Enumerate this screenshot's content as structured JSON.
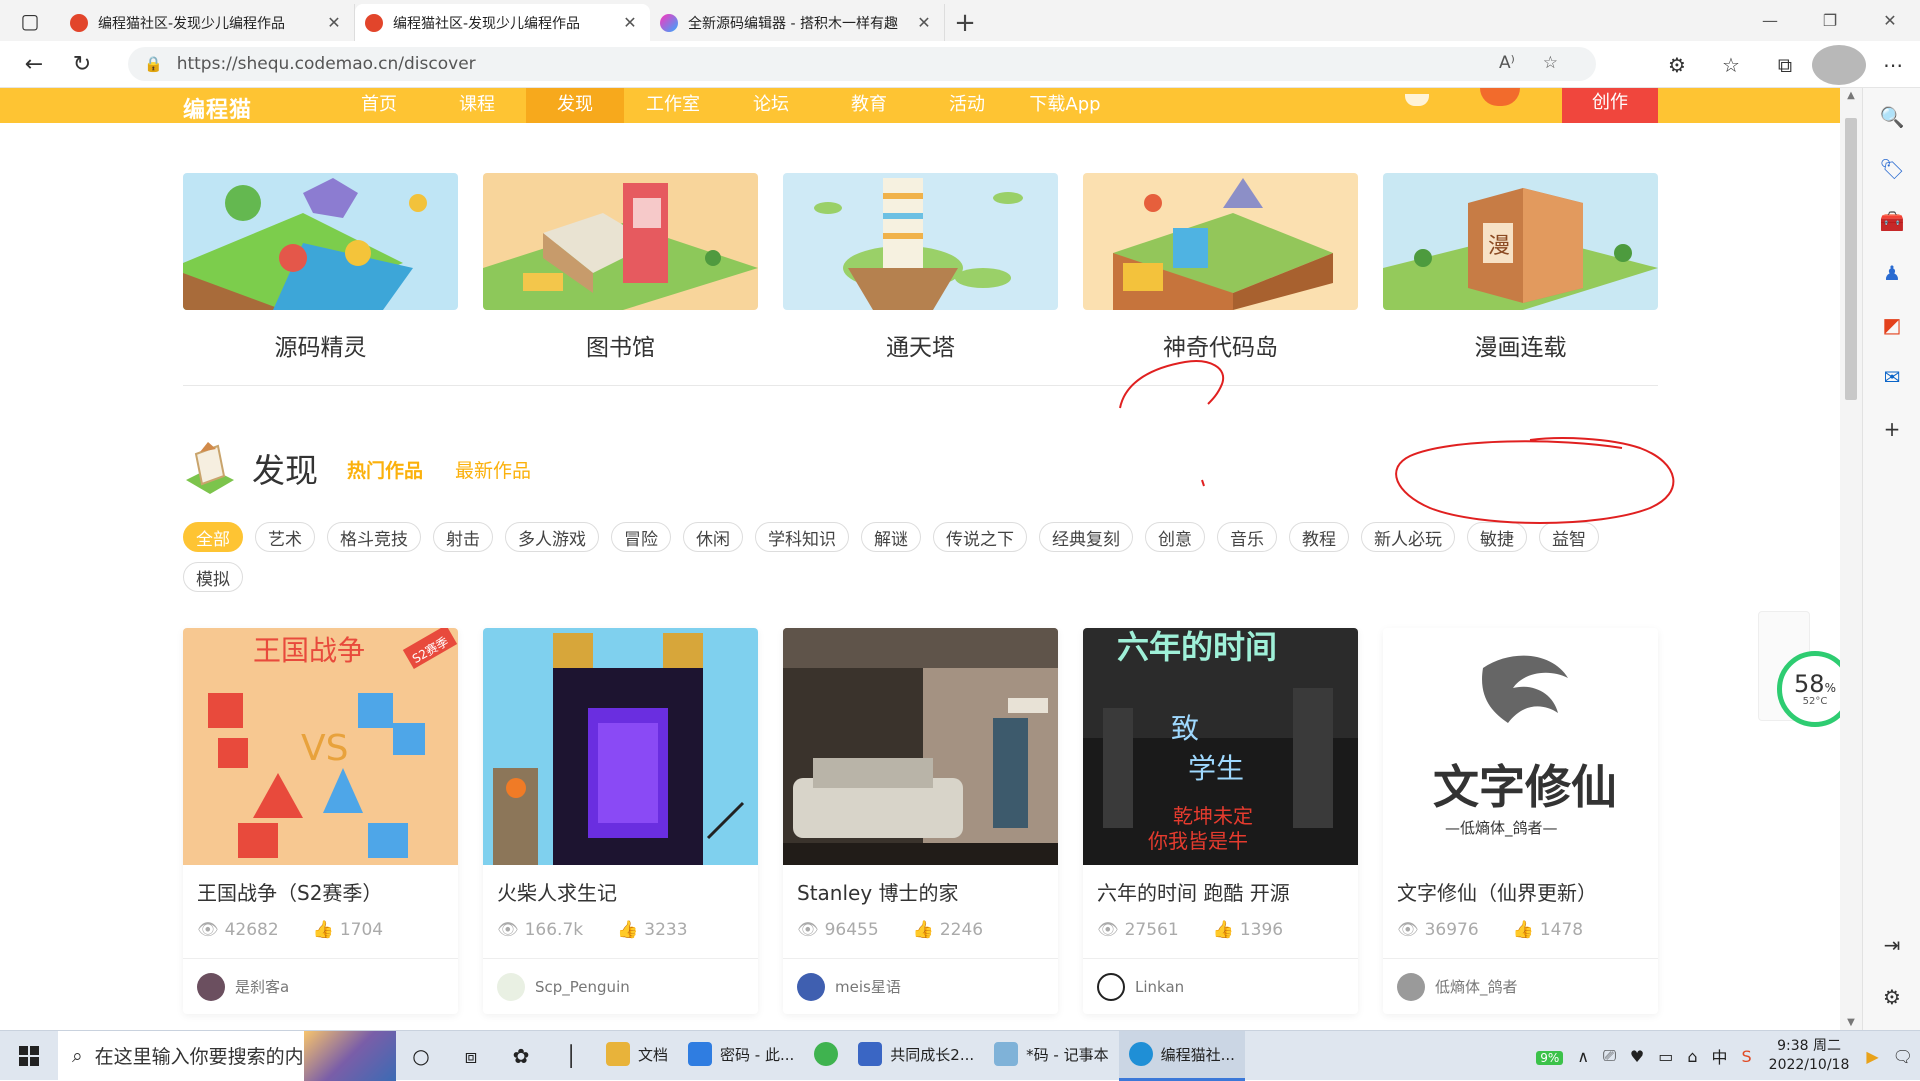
{
  "browser": {
    "tabs": [
      {
        "title": "编程猫社区-发现少儿编程作品",
        "active": false
      },
      {
        "title": "编程猫社区-发现少儿编程作品",
        "active": true
      },
      {
        "title": "全新源码编辑器 - 搭积木一样有趣",
        "active": false
      }
    ],
    "url": "https://shequ.codemao.cn/discover"
  },
  "site_nav": {
    "logo": "编程猫",
    "items": [
      "首页",
      "课程",
      "发现",
      "工作室",
      "论坛",
      "教育",
      "活动",
      "下载App"
    ],
    "active_item": "发现",
    "create_label": "创作"
  },
  "features": [
    {
      "label": "源码精灵",
      "colors": [
        "#bfe5f5",
        "#7ccd4c"
      ]
    },
    {
      "label": "图书馆",
      "colors": [
        "#f8d59b",
        "#8dc85a"
      ]
    },
    {
      "label": "通天塔",
      "colors": [
        "#cfeaf6",
        "#9ad068"
      ]
    },
    {
      "label": "神奇代码岛",
      "colors": [
        "#fbe0b0",
        "#93c65a"
      ]
    },
    {
      "label": "漫画连载",
      "colors": [
        "#c9e8f3",
        "#94ca5b"
      ]
    }
  ],
  "discover": {
    "title": "发现",
    "hot_tab": "热门作品",
    "new_tab": "最新作品"
  },
  "tags": [
    "全部",
    "艺术",
    "格斗竞技",
    "射击",
    "多人游戏",
    "冒险",
    "休闲",
    "学科知识",
    "解谜",
    "传说之下",
    "经典复刻",
    "创意",
    "音乐",
    "教程",
    "新人必玩",
    "敏捷",
    "益智",
    "模拟"
  ],
  "active_tag": "全部",
  "works": [
    {
      "title": "王国战争（S2赛季）",
      "views": "42682",
      "likes": "1704",
      "author": "是刹客a"
    },
    {
      "title": "火柴人求生记",
      "views": "166.7k",
      "likes": "3233",
      "author": "Scp_Penguin"
    },
    {
      "title": "Stanley 博士的家",
      "views": "96455",
      "likes": "2246",
      "author": "meis星语"
    },
    {
      "title": "六年的时间 跑酷 开源",
      "views": "27561",
      "likes": "1396",
      "author": "Linkan"
    },
    {
      "title": "文字修仙（仙界更新）",
      "views": "36976",
      "likes": "1478",
      "author": "低熵体_鸽者"
    }
  ],
  "cover_text": {
    "w1": "王国战争",
    "w1_badge": "S2赛季",
    "w4_line1": "六年的时间",
    "w4_line2": "致",
    "w4_line3": "学生",
    "w4_line4": "乾坤未定",
    "w4_line5": "你我皆是牛",
    "w5_main": "文字修仙",
    "w5_sub": "—低熵体_鸽者—"
  },
  "widget": {
    "percent": "58",
    "percent_unit": "%",
    "temp": "52°C"
  },
  "ime": {
    "label": "中"
  },
  "taskbar": {
    "search_placeholder": "在这里输入你要搜索的内容",
    "apps": [
      {
        "label": "文档",
        "color": "#e8b33a"
      },
      {
        "label": "密码 - 此...",
        "color": "#2f7de1"
      },
      {
        "label": "",
        "color": "#3fb34f"
      },
      {
        "label": "共同成长2...",
        "color": "#3a66c4"
      },
      {
        "label": "*码 - 记事本",
        "color": "#7fb2d8"
      },
      {
        "label": "编程猫社...",
        "color": "#1f8fd6"
      }
    ],
    "battery": "9%",
    "time": "9:38 周二",
    "date": "2022/10/18"
  }
}
